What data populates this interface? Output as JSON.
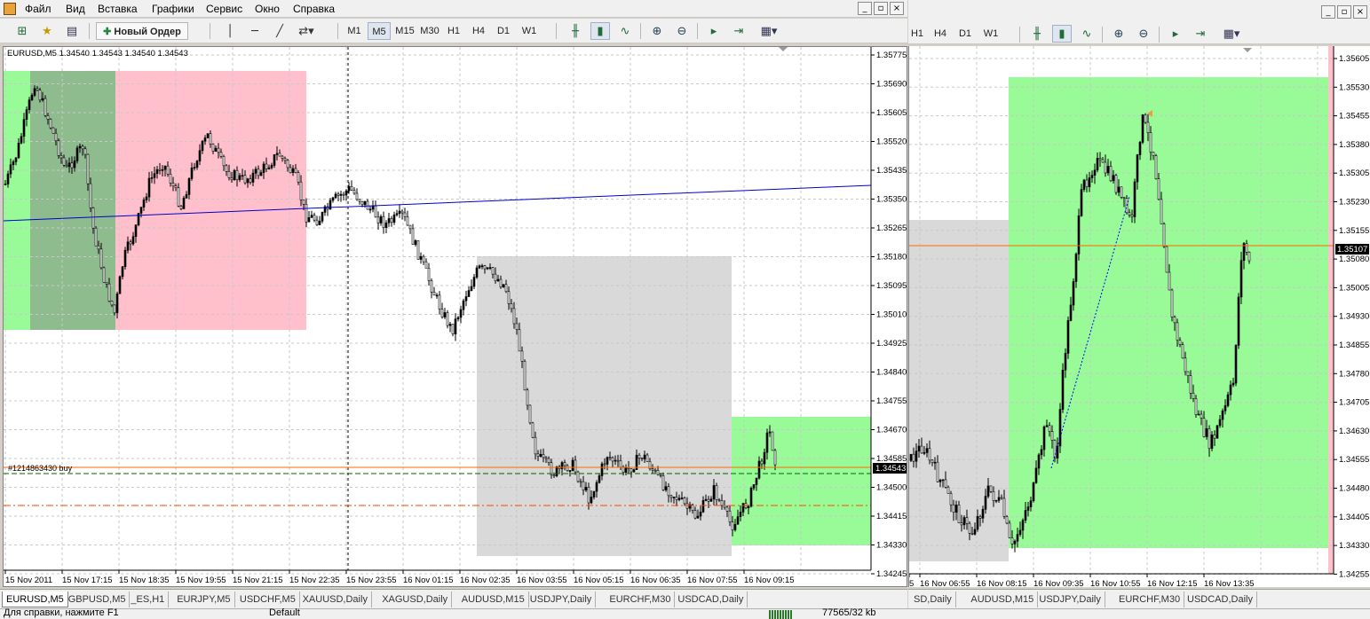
{
  "menu": {
    "items": [
      "Файл",
      "Вид",
      "Вставка",
      "Графики",
      "Сервис",
      "Окно",
      "Справка"
    ]
  },
  "toolbar": {
    "new_order": "Новый Ордер",
    "timeframes": [
      "M1",
      "M5",
      "M15",
      "M30",
      "H1",
      "H4",
      "D1",
      "W1"
    ],
    "active_tf": "M5"
  },
  "toolbar2": {
    "timeframes": [
      "H1",
      "H4",
      "D1",
      "W1"
    ]
  },
  "chart1": {
    "info": "EURUSD,M5  1.34540 1.34543 1.34540 1.34543",
    "order_label": "#1214863430 buy",
    "price_labels": [
      "1.35775",
      "1.35690",
      "1.35605",
      "1.35520",
      "1.35435",
      "1.35350",
      "1.35265",
      "1.35180",
      "1.35095",
      "1.35010",
      "1.34925",
      "1.34840",
      "1.34755",
      "1.34670",
      "1.34585",
      "1.34500",
      "1.34415",
      "1.34330",
      "1.34245"
    ],
    "current_price": "1.34543",
    "time_labels": [
      "15 Nov 2011",
      "15 Nov 17:15",
      "15 Nov 18:35",
      "15 Nov 19:55",
      "15 Nov 21:15",
      "15 Nov 22:35",
      "15 Nov 23:55",
      "16 Nov 01:15",
      "16 Nov 02:35",
      "16 Nov 03:55",
      "16 Nov 05:15",
      "16 Nov 06:35",
      "16 Nov 07:55",
      "16 Nov 09:15"
    ]
  },
  "chart2": {
    "price_labels": [
      "1.35605",
      "1.35530",
      "1.35455",
      "1.35380",
      "1.35305",
      "1.35230",
      "1.35155",
      "1.35080",
      "1.35005",
      "1.34930",
      "1.34855",
      "1.34780",
      "1.34705",
      "1.34630",
      "1.34555",
      "1.34480",
      "1.34405",
      "1.34330",
      "1.34255"
    ],
    "current_price": "1.35107",
    "time_labels": [
      "5",
      "16 Nov 06:55",
      "16 Nov 08:15",
      "16 Nov 09:35",
      "16 Nov 10:55",
      "16 Nov 12:15",
      "16 Nov 13:35"
    ]
  },
  "tabs1": [
    "EURUSD,M5",
    "GBPUSD,M5",
    "_ES,H1",
    "EURJPY,M5",
    "USDCHF,M5",
    "XAUUSD,Daily",
    "XAGUSD,Daily",
    "AUDUSD,M15",
    "USDJPY,Daily",
    "EURCHF,M30",
    "USDCAD,Daily"
  ],
  "tabs2": [
    "SD,Daily",
    "AUDUSD,M15",
    "USDJPY,Daily",
    "EURCHF,M30",
    "USDCAD,Daily"
  ],
  "status": {
    "help": "Для справки, нажмите F1",
    "profile": "Default",
    "traffic": "77565/32 kb"
  },
  "colors": {
    "green_zone": "#98fb98",
    "pink_zone": "#ffc0cb",
    "gray_zone": "#d9d9d9",
    "dark_zone": "#8fbc8f",
    "trend_line": "#0000cd",
    "order_line": "#ff6a00",
    "sl_line": "#006400",
    "tp_line": "#ff4500"
  }
}
